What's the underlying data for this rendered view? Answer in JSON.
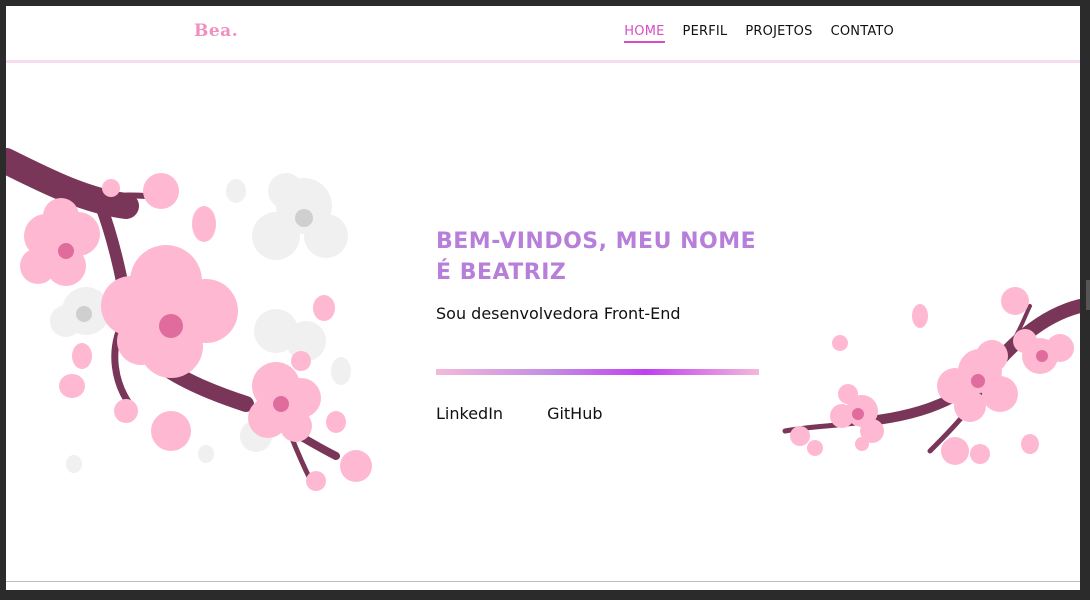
{
  "brand": {
    "logo": "Bea."
  },
  "nav": {
    "items": [
      {
        "label": "HOME",
        "active": true
      },
      {
        "label": "PERFIL",
        "active": false
      },
      {
        "label": "PROJETOS",
        "active": false
      },
      {
        "label": "CONTATO",
        "active": false
      }
    ]
  },
  "hero": {
    "title": "BEM-VINDOS, MEU NOME É BEATRIZ",
    "subtitle": "Sou desenvolvedora Front-End",
    "links": [
      {
        "label": "LinkedIn"
      },
      {
        "label": "GitHub"
      }
    ]
  },
  "colors": {
    "accent": "#d64fc4",
    "title": "#b77fd9",
    "logo": "#f08fc0",
    "petal": "#ffb8d2",
    "branch": "#7a3658"
  },
  "icons": [
    "cherry-blossom-left-illustration",
    "cherry-blossom-right-illustration"
  ]
}
